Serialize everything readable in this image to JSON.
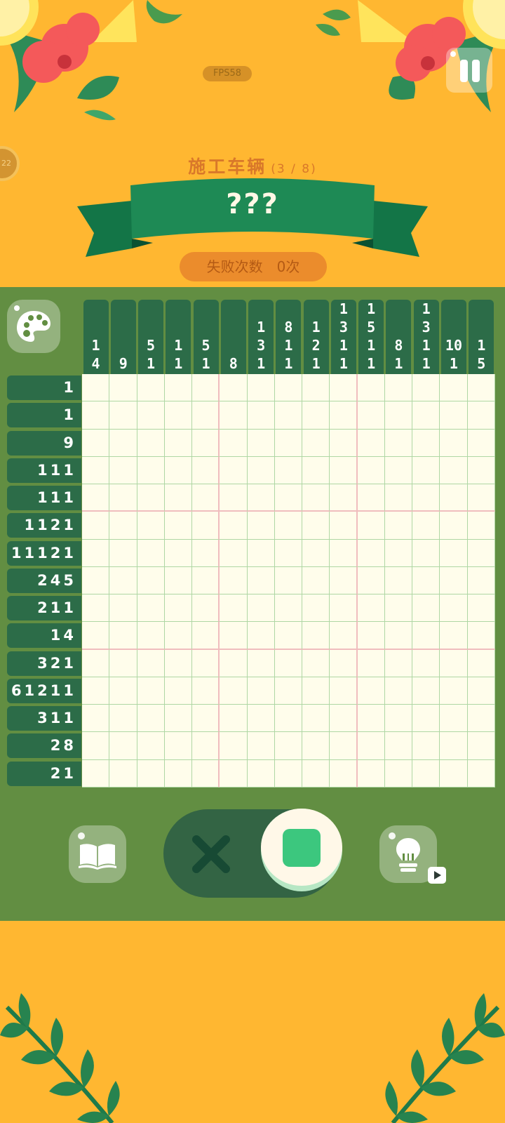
{
  "app": {
    "fps_label": "FPS58",
    "coin_count": "22"
  },
  "header": {
    "puzzle_category": "施工车辆",
    "progress": "(3 / 8)",
    "puzzle_name": "???",
    "fail_label": "失败次数",
    "fail_count": "0次"
  },
  "board": {
    "column_clues": [
      [
        "1",
        "4"
      ],
      [
        "9"
      ],
      [
        "5",
        "1"
      ],
      [
        "1",
        "1"
      ],
      [
        "5",
        "1"
      ],
      [
        "8"
      ],
      [
        "1",
        "3",
        "1"
      ],
      [
        "8",
        "1",
        "1"
      ],
      [
        "1",
        "2",
        "1"
      ],
      [
        "1",
        "3",
        "1",
        "1"
      ],
      [
        "1",
        "5",
        "1",
        "1"
      ],
      [
        "8",
        "1"
      ],
      [
        "1",
        "3",
        "1",
        "1"
      ],
      [
        "10",
        "1"
      ],
      [
        "1",
        "5"
      ]
    ],
    "row_clues": [
      "1",
      "1",
      "9",
      "111",
      "111",
      "1121",
      "11121",
      "245",
      "211",
      "14",
      "321",
      "61211",
      "311",
      "28",
      "21"
    ],
    "size": 15,
    "filled_cells": 0
  },
  "controls": {
    "book_button": "book-icon",
    "palette_button": "palette-icon",
    "mark_mode": "cross-icon",
    "fill_mode": "fill-square-icon",
    "active_mode": "fill",
    "hint_button": "lightbulb-icon",
    "hint_badge": "video-play-icon"
  },
  "colors": {
    "background": "#FFB731",
    "panel": "#628E42",
    "clue_bg": "#2C6C48",
    "grid_bg": "#FFFDEB",
    "grid_line": "#AFD7A4",
    "grid_major_line": "#F0BDBE",
    "fill_accent": "#3CC77E",
    "ribbon": "#1E8A55"
  }
}
